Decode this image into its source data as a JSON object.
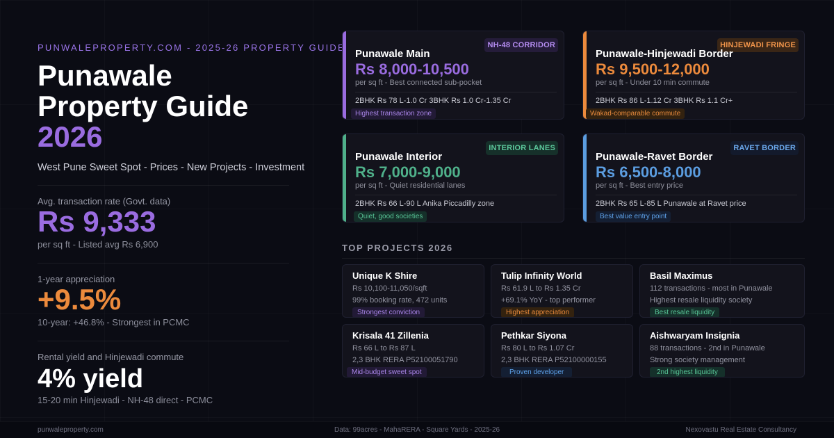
{
  "hero": {
    "eyebrow": "PUNWALEPROPERTY.COM - 2025-26 PROPERTY GUIDE",
    "title_line1": "Punawale",
    "title_line2": "Property Guide",
    "title_year": "2026",
    "subtitle": "West Pune Sweet Spot - Prices - New Projects - Investment"
  },
  "stats": [
    {
      "label": "Avg. transaction rate (Govt. data)",
      "value": "Rs 9,333",
      "note": "per sq ft - Listed avg Rs 6,900",
      "color": "#9a6ce0"
    },
    {
      "label": "1-year appreciation",
      "value": "+9.5%",
      "note": "10-year: +46.8% - Strongest in PCMC",
      "color": "#ec8a3c"
    },
    {
      "label": "Rental yield and Hinjewadi commute",
      "value": "4% yield",
      "note": "15-20 min Hinjewadi - NH-48 direct - PCMC",
      "color": "#ffffff"
    }
  ],
  "zones": [
    {
      "name": "Punawale Main",
      "tag": "NH-48 CORRIDOR",
      "price": "Rs 8,000-10,500",
      "unit": "per sq ft - Best connected sub-pocket",
      "detail": "2BHK Rs 78 L-1.0 Cr 3BHK Rs 1.0 Cr-1.35 Cr",
      "note": "Highest transaction zone",
      "color": "#9a6ce0",
      "tag_bg": "#251c3a",
      "tag_fg": "#b48cf0",
      "note_bg": "#221a36",
      "note_fg": "#a985e8"
    },
    {
      "name": "Punawale-Hinjewadi Border",
      "tag": "HINJEWADI FRINGE",
      "price": "Rs 9,500-12,000",
      "unit": "per sq ft - Under 10 min commute",
      "detail": "2BHK Rs 86 L-1.12 Cr 3BHK Rs 1.1 Cr+",
      "note": "Wakad-comparable commute",
      "color": "#ec8a3c",
      "tag_bg": "#3a2616",
      "tag_fg": "#f0944a",
      "note_bg": "#33220f",
      "note_fg": "#e88a3c"
    },
    {
      "name": "Punawale Interior",
      "tag": "INTERIOR LANES",
      "price": "Rs 7,000-9,000",
      "unit": "per sq ft - Quiet residential lanes",
      "detail": "2BHK Rs 66 L-90 L Anika Piccadilly zone",
      "note": "Quiet, good societies",
      "color": "#4fb08a",
      "tag_bg": "#16302a",
      "tag_fg": "#5cc79b",
      "note_bg": "#15302a",
      "note_fg": "#58c496"
    },
    {
      "name": "Punawale-Ravet Border",
      "tag": "RAVET BORDER",
      "price": "Rs 6,500-8,000",
      "unit": "per sq ft - Best entry price",
      "detail": "2BHK Rs 65 L-85 L Punawale at Ravet price",
      "note": "Best value entry point",
      "color": "#5b9de0",
      "tag_bg": "#131a2c",
      "tag_fg": "#6ba8ec",
      "note_bg": "#141f33",
      "note_fg": "#5ea1e8"
    }
  ],
  "projects_section": {
    "title": "TOP PROJECTS 2026",
    "projects": [
      {
        "name": "Unique K Shire",
        "line1": "Rs 10,100-11,050/sqft",
        "line2": "99% booking rate, 472 units",
        "badge": "Strongest conviction",
        "badge_bg": "#221a36",
        "badge_fg": "#a985e8"
      },
      {
        "name": "Tulip Infinity World",
        "line1": "Rs 61.9 L to Rs 1.35 Cr",
        "line2": "+69.1% YoY - top performer",
        "badge": "Highest appreciation",
        "badge_bg": "#33220f",
        "badge_fg": "#e88a3c"
      },
      {
        "name": "Basil Maximus",
        "line1": "112 transactions - most in Punawale",
        "line2": "Highest resale liquidity society",
        "badge": "Best resale liquidity",
        "badge_bg": "#15302a",
        "badge_fg": "#58c496"
      },
      {
        "name": "Krisala 41 Zillenia",
        "line1": "Rs 66 L to Rs 87 L",
        "line2": "2,3 BHK RERA P52100051790",
        "badge": "Mid-budget sweet spot",
        "badge_bg": "#221a36",
        "badge_fg": "#a985e8"
      },
      {
        "name": "Pethkar Siyona",
        "line1": "Rs 80 L to Rs 1.07 Cr",
        "line2": "2,3 BHK RERA P52100000155",
        "badge": "Proven developer",
        "badge_bg": "#141f33",
        "badge_fg": "#5ea1e8"
      },
      {
        "name": "Aishwaryam Insignia",
        "line1": "88 transactions - 2nd in Punawale",
        "line2": "Strong society management",
        "badge": "2nd highest liquidity",
        "badge_bg": "#15302a",
        "badge_fg": "#58c496"
      }
    ]
  },
  "footer": {
    "site": "punwaleproperty.com",
    "sources": "Data: 99acres - MahaRERA - Square Yards - 2025-26",
    "company": "Nexovastu Real Estate Consultancy"
  }
}
